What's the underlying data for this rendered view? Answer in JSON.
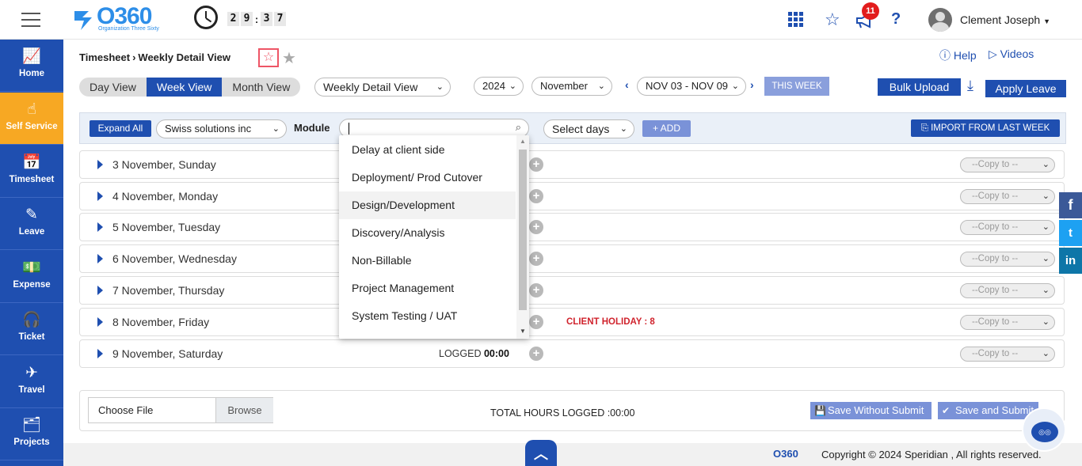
{
  "app": {
    "logo_text": "O360",
    "logo_subtitle": "Organization Three Sixty",
    "timer": [
      "2",
      "9",
      "3",
      "7"
    ],
    "notifications_count": "11",
    "user_name": "Clement Joseph"
  },
  "sidebar": {
    "items": [
      {
        "label": "Home",
        "icon": "home-chart-icon"
      },
      {
        "label": "Self Service",
        "icon": "hand-pointer-icon"
      },
      {
        "label": "Timesheet",
        "icon": "calendar-icon"
      },
      {
        "label": "Leave",
        "icon": "edit-icon"
      },
      {
        "label": "Expense",
        "icon": "money-icon"
      },
      {
        "label": "Ticket",
        "icon": "headset-icon"
      },
      {
        "label": "Travel",
        "icon": "plane-icon"
      },
      {
        "label": "Projects",
        "icon": "folders-icon"
      }
    ],
    "active_index": 1
  },
  "breadcrumb": {
    "parent": "Timesheet",
    "current": "Weekly Detail View"
  },
  "header_links": {
    "help": "Help",
    "videos": "Videos"
  },
  "view_tabs": {
    "day": "Day View",
    "week": "Week View",
    "month": "Month View",
    "active": "week"
  },
  "view_select": "Weekly Detail View",
  "year_select": "2024",
  "month_select": "November",
  "week_range": "NOV 03 - NOV 09",
  "this_week": "THIS WEEK",
  "bulk_upload": "Bulk Upload",
  "apply_leave": "Apply Leave",
  "filters": {
    "expand_all": "Expand All",
    "client": "Swiss solutions inc",
    "module_label": "Module",
    "module_value": "",
    "select_days": "Select days",
    "add": "ADD",
    "import": "IMPORT FROM LAST WEEK"
  },
  "module_options": [
    "Delay at client side",
    "Deployment/ Prod Cutover",
    "Design/Development",
    "Discovery/Analysis",
    "Non-Billable",
    "Project Management",
    "System Testing / UAT"
  ],
  "module_hovered_index": 2,
  "days": [
    {
      "label": "3 November, Sunday",
      "note": "",
      "logged": ""
    },
    {
      "label": "4 November, Monday",
      "note": "",
      "logged": ""
    },
    {
      "label": "5 November, Tuesday",
      "note": "",
      "logged": ""
    },
    {
      "label": "6 November, Wednesday",
      "note": "",
      "logged": ""
    },
    {
      "label": "7 November, Thursday",
      "note": "",
      "logged": ""
    },
    {
      "label": "8 November, Friday",
      "note": "CLIENT HOLIDAY : 8",
      "logged": ""
    },
    {
      "label": "9 November, Saturday",
      "note": "",
      "logged": "00:00"
    }
  ],
  "logged_label": "LOGGED",
  "copy_to": "--Copy to --",
  "bottom": {
    "choose_file": "Choose File",
    "browse": "Browse",
    "total_hours": "TOTAL HOURS LOGGED  :00:00",
    "save_without_submit": "Save Without Submit",
    "save_and_submit": "Save and Submit"
  },
  "footer": {
    "logo": "O360",
    "copyright": "Copyright © 2024 Speridian , All rights reserved."
  },
  "social": [
    "f",
    "t",
    "in"
  ]
}
